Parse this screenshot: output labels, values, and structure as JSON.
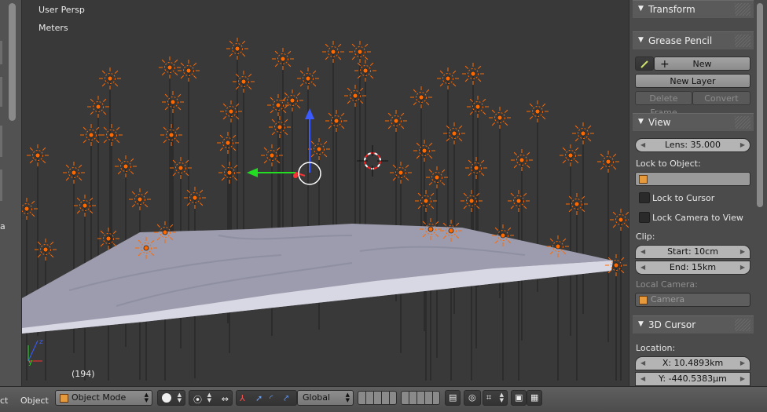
{
  "viewport": {
    "view_name": "User Persp",
    "units": "Meters",
    "frame_number": "(194)"
  },
  "left_panel": {
    "cut_label": "a"
  },
  "properties": {
    "transform": {
      "title": "Transform"
    },
    "grease_pencil": {
      "title": "Grease Pencil",
      "new_label": "New",
      "new_layer_label": "New Layer",
      "delete_frame_label": "Delete Frame",
      "convert_label": "Convert"
    },
    "view": {
      "title": "View",
      "lens": "Lens: 35.000",
      "lock_to_object_label": "Lock to Object:",
      "lock_to_cursor_label": "Lock to Cursor",
      "lock_camera_label": "Lock Camera to View",
      "clip_label": "Clip:",
      "clip_start": "Start: 10cm",
      "clip_end": "End: 15km",
      "local_camera_label": "Local Camera:",
      "local_camera_value": "Camera"
    },
    "cursor": {
      "title": "3D Cursor",
      "location_label": "Location:",
      "x": "X: 10.4893km",
      "y": "Y: -440.5383µm"
    }
  },
  "bottom_bar": {
    "cut_menu": "ct",
    "object_menu": "Object",
    "mode": "Object Mode",
    "orientation": "Global"
  },
  "colors": {
    "viewport_bg": "#393939",
    "lamp_orange": "#ff6a00",
    "axis_x": "#ff3030",
    "axis_y": "#22dd22",
    "axis_z": "#3b5bff"
  }
}
